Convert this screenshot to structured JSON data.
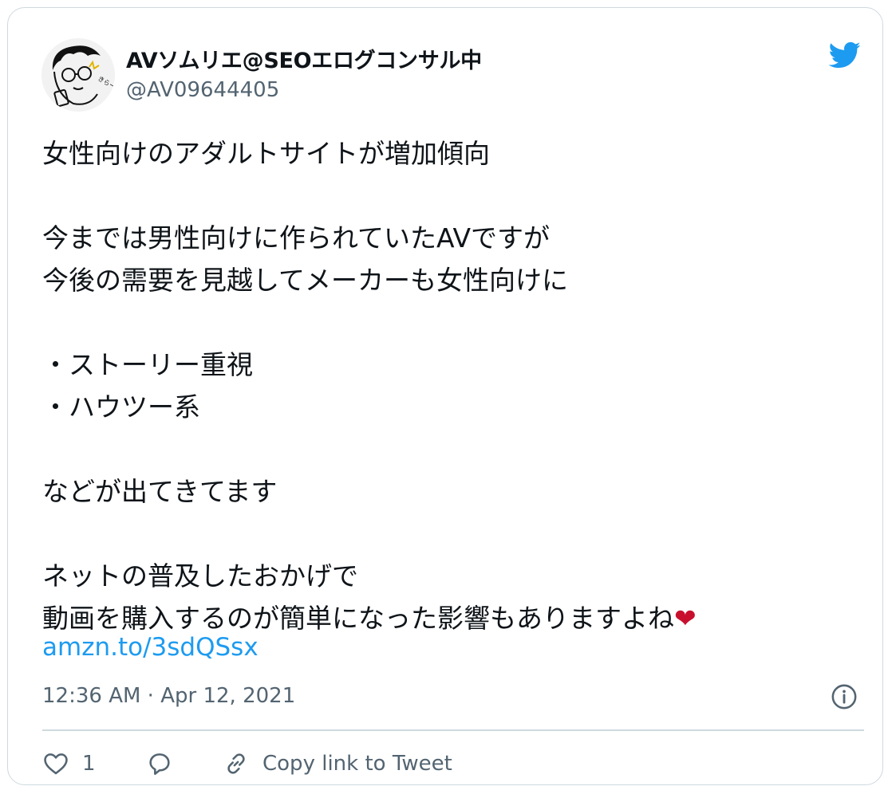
{
  "user": {
    "display_name": "AVソムリエ@SEOエログコンサル中",
    "handle": "@AV09644405",
    "avatar_icon": "cartoon-avatar-icon"
  },
  "tweet": {
    "text": "女性向けのアダルトサイトが増加傾向\n\n今までは男性向けに作られていたAVですが\n今後の需要を見越してメーカーも女性向けに\n\n・ストーリー重視\n・ハウツー系\n\nなどが出てきてます\n\nネットの普及したおかげで\n動画を購入するのが簡単になった影響もありますよね",
    "emoji": "❤",
    "link": "amzn.to/3sdQSsx",
    "timestamp": "12:36 AM · Apr 12, 2021"
  },
  "actions": {
    "like_count": "1",
    "copy_link_label": "Copy link to Tweet"
  },
  "colors": {
    "link": "#1d9bf0",
    "secondary_text": "#536471",
    "border": "#cfd9de",
    "heart_emoji": "#c8102e"
  }
}
